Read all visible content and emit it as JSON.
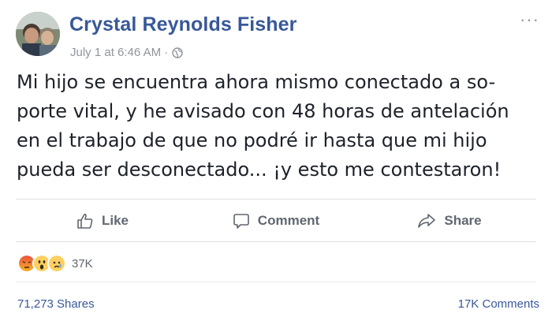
{
  "author": {
    "name": "Crystal Reynolds Fisher",
    "timestamp": "July 1 at 6:46 AM",
    "separator": "·",
    "privacy_icon": "globe-icon"
  },
  "menu": {
    "more_label": "···"
  },
  "post": {
    "text": "Mi hijo se encuentra ahora mismo conectado a so-\nporte vital, y he avisado con 48 horas de antelación\nen el trabajo de que no podré ir hasta que mi hijo\npueda ser desconectado... ¡y esto me contestaron!"
  },
  "actions": {
    "like_label": "Like",
    "comment_label": "Comment",
    "share_label": "Share"
  },
  "reactions": {
    "types": [
      "angry-reaction-icon",
      "wow-reaction-icon",
      "sad-reaction-icon"
    ],
    "count": "37K"
  },
  "stats": {
    "shares": "71,273 Shares",
    "comments": "17K Comments"
  },
  "colors": {
    "link": "#385898",
    "meta": "#90949c",
    "divider": "#dddfe2"
  }
}
